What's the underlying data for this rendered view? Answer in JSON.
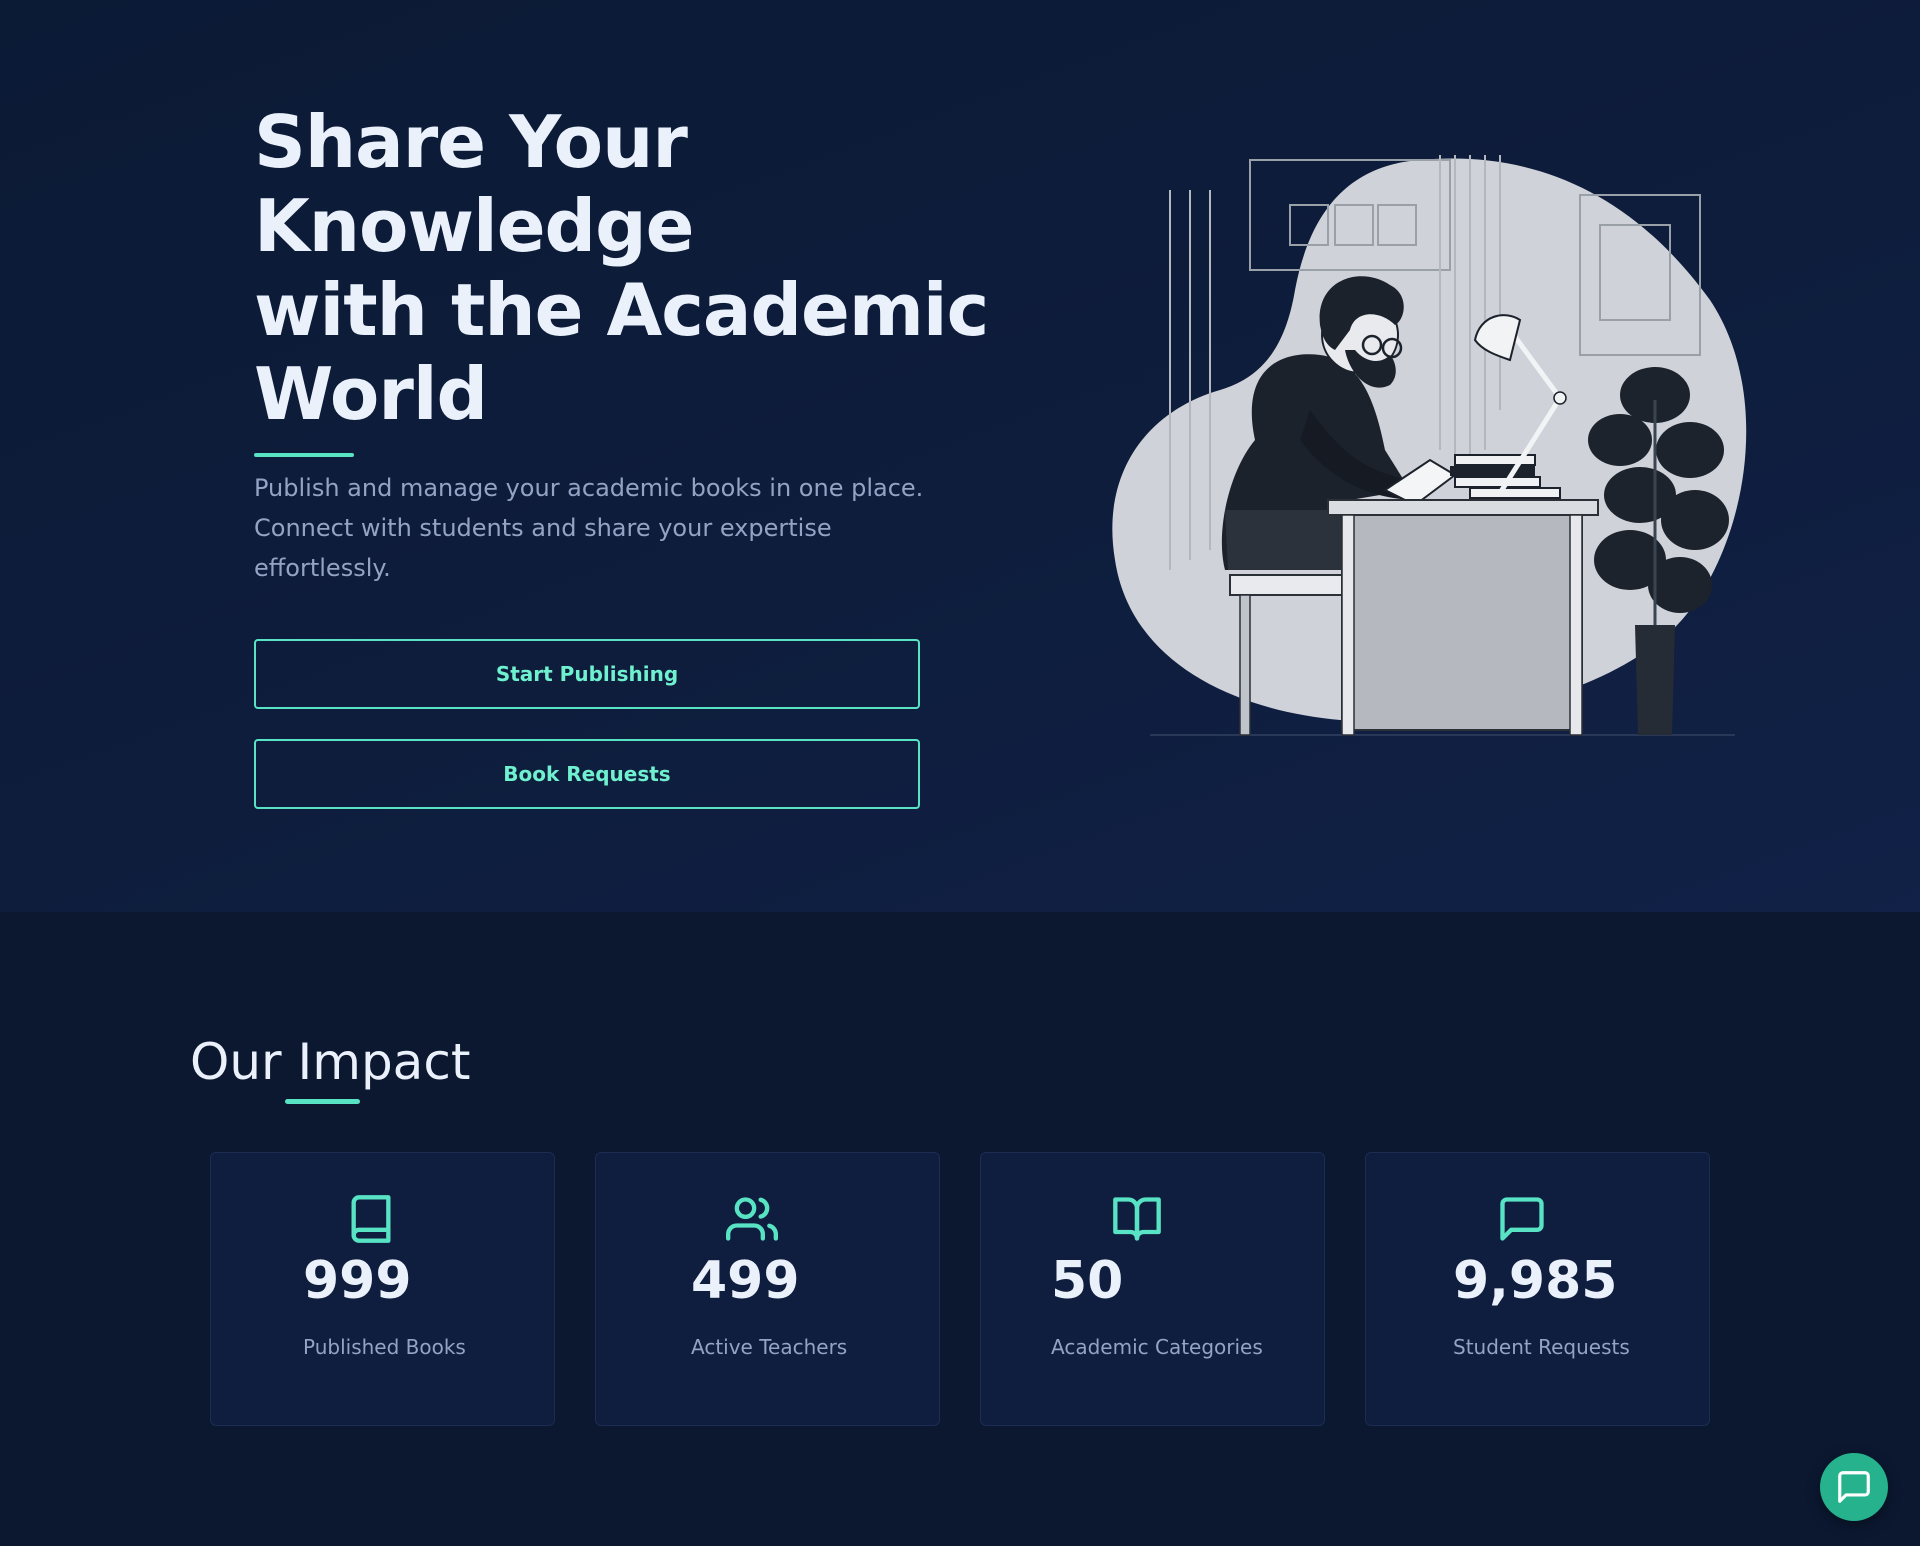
{
  "hero": {
    "title_lines": [
      "Share Your",
      "Knowledge",
      "with the Academic",
      "World"
    ],
    "description_lines": [
      "Publish and manage your academic books in one place.",
      "Connect with students and share your expertise",
      "effortlessly."
    ],
    "buttons": {
      "start_publishing": "Start Publishing",
      "book_requests": "Book Requests"
    },
    "illustration_icon": "person-reading-at-desk-illustration"
  },
  "impact": {
    "title": "Our Impact",
    "stats": [
      {
        "icon": "book-icon",
        "value": "999",
        "label": "Published Books"
      },
      {
        "icon": "users-icon",
        "value": "499",
        "label": "Active Teachers"
      },
      {
        "icon": "open-book-icon",
        "value": "50",
        "label": "Academic Categories"
      },
      {
        "icon": "message-square-icon",
        "value": "9,985",
        "label": "Student Requests"
      }
    ]
  },
  "chat_button": {
    "icon": "chat-bubble-icon"
  },
  "colors": {
    "background": "#0b1830",
    "accent": "#58e3c4",
    "text": "#eaf1fb",
    "muted_text": "#94a3c4",
    "card": "#0f1d3e",
    "chat_button": "#25b28d"
  }
}
